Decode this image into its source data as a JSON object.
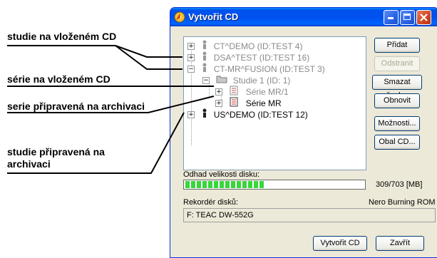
{
  "annotations": {
    "study_on_cd": "studie na vloženém CD",
    "series_on_cd": "série na vloženém CD",
    "series_ready": "serie připravená na archivaci",
    "study_ready_line1": "studie připravená na",
    "study_ready_line2": "archivaci"
  },
  "window": {
    "title": "Vytvořit CD"
  },
  "tree": {
    "items": [
      {
        "label": "CT^DEMO (ID:TEST 4)",
        "state": "on-cd"
      },
      {
        "label": "DSA^TEST (ID:TEST 16)",
        "state": "on-cd"
      },
      {
        "label": "CT-MR^FUSION (ID:TEST 3)",
        "state": "on-cd"
      },
      {
        "label": "Studie 1 (ID: 1)",
        "state": "on-cd"
      },
      {
        "label": "Série MR/1",
        "state": "on-cd"
      },
      {
        "label": "Série MR",
        "state": "ready"
      },
      {
        "label": "US^DEMO (ID:TEST 12)",
        "state": "ready"
      }
    ]
  },
  "buttons": {
    "add": "Přidat",
    "remove": "Odstranit",
    "clear_all": "Smazat všechno",
    "refresh": "Obnovit",
    "options": "Možnosti...",
    "cover": "Obal CD...",
    "create": "Vytvořit CD",
    "close": "Zavřít"
  },
  "disk": {
    "label": "Odhad velikosti disku:",
    "value_text": "309/703 [MB]",
    "fill_fraction": 0.44
  },
  "recorder": {
    "label": "Rekordér disků:",
    "software": "Nero Burning ROM",
    "device": "F: TEAC    DW-552G"
  },
  "colors": {
    "titlebar": "#0054e3",
    "progress": "#37d63b",
    "dialog_bg": "#ece9d8"
  }
}
